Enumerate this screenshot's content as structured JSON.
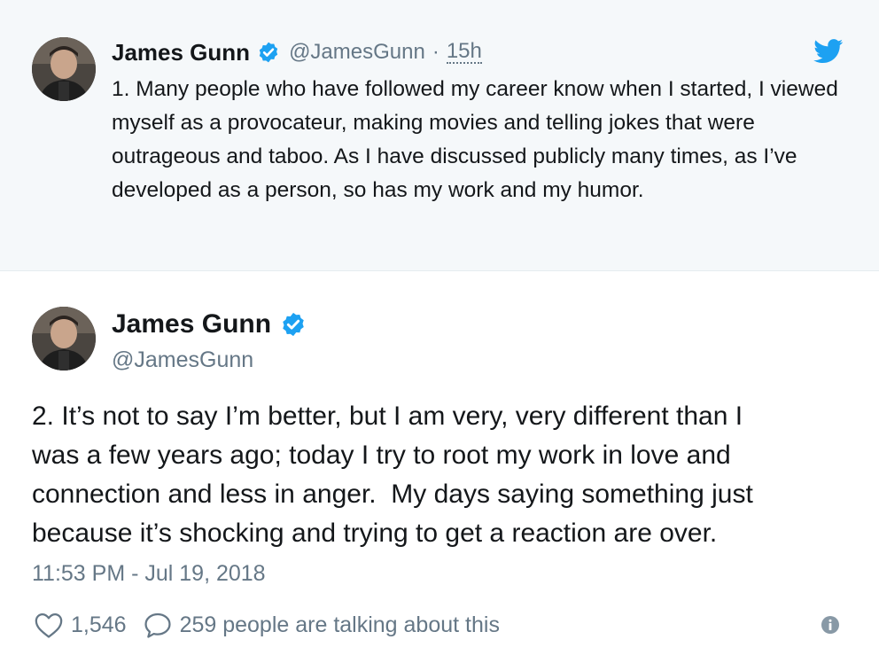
{
  "parent_tweet": {
    "author_name": "James Gunn",
    "screen_name": "@JamesGunn",
    "separator": "·",
    "time_ago": "15h",
    "text": "1. Many people who have followed my career know when I started, I viewed myself as a provocateur, making movies and telling jokes that were outrageous and taboo. As I have discussed publicly many times, as I’ve developed as a person, so has my work and my humor."
  },
  "main_tweet": {
    "author_name": "James Gunn",
    "screen_name": "@JamesGunn",
    "text": "2. It’s not to say I’m better, but I am very, very different than I\nwas a few years ago; today I try to root my work in love and\nconnection and less in anger.  My days saying something just\nbecause it’s shocking and trying to get a reaction are over.",
    "timestamp": "11:53 PM - Jul 19, 2018",
    "likes_count": "1,546",
    "conversation_label": "259 people are talking about this"
  },
  "icons": {
    "verified": "verified-badge-icon",
    "brand": "twitter-bird-icon",
    "like": "heart-icon",
    "reply": "speech-bubble-icon",
    "info": "info-icon"
  },
  "colors": {
    "verified_blue": "#1da1f2",
    "secondary_text": "#657786",
    "parent_background": "#f5f8fa"
  }
}
